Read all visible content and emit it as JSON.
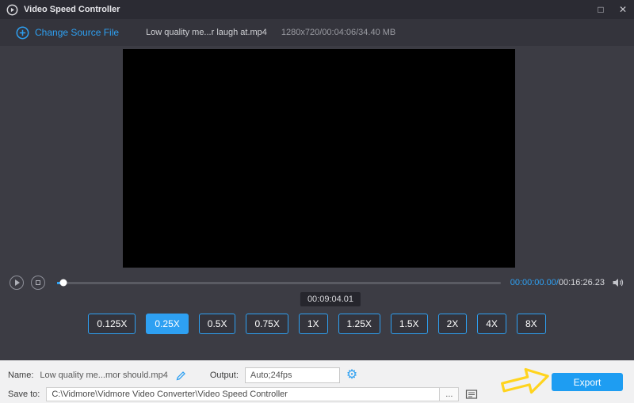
{
  "window": {
    "title": "Video Speed Controller",
    "maximize_glyph": "□",
    "close_glyph": "✕"
  },
  "toolbar": {
    "change_source_label": "Change Source File",
    "file_name": "Low quality me...r laugh at.mp4",
    "file_info": "1280x720/00:04:06/34.40 MB"
  },
  "player": {
    "tooltip_time": "00:09:04.01",
    "current_time": "00:00:00.00/",
    "total_time": "00:16:26.23"
  },
  "speeds": {
    "options": [
      {
        "label": "0.125X",
        "selected": false
      },
      {
        "label": "0.25X",
        "selected": true
      },
      {
        "label": "0.5X",
        "selected": false
      },
      {
        "label": "0.75X",
        "selected": false
      },
      {
        "label": "1X",
        "selected": false
      },
      {
        "label": "1.25X",
        "selected": false
      },
      {
        "label": "1.5X",
        "selected": false
      },
      {
        "label": "2X",
        "selected": false
      },
      {
        "label": "4X",
        "selected": false
      },
      {
        "label": "8X",
        "selected": false
      }
    ]
  },
  "footer": {
    "name_label": "Name:",
    "name_value": "Low quality me...mor should.mp4",
    "output_label": "Output:",
    "output_value": "Auto;24fps",
    "export_label": "Export",
    "save_to_label": "Save to:",
    "save_to_value": "C:\\Vidmore\\Vidmore Video Converter\\Video Speed Controller",
    "browse_label": "..."
  },
  "colors": {
    "accent": "#1e9df2",
    "titlebar": "#2b2b33",
    "toolbar": "#34343c",
    "main_bg": "#3c3c44",
    "footer_bg": "#f1f1f2",
    "export_button": "#1e9df2",
    "annotation_arrow": "#ffd41e"
  }
}
